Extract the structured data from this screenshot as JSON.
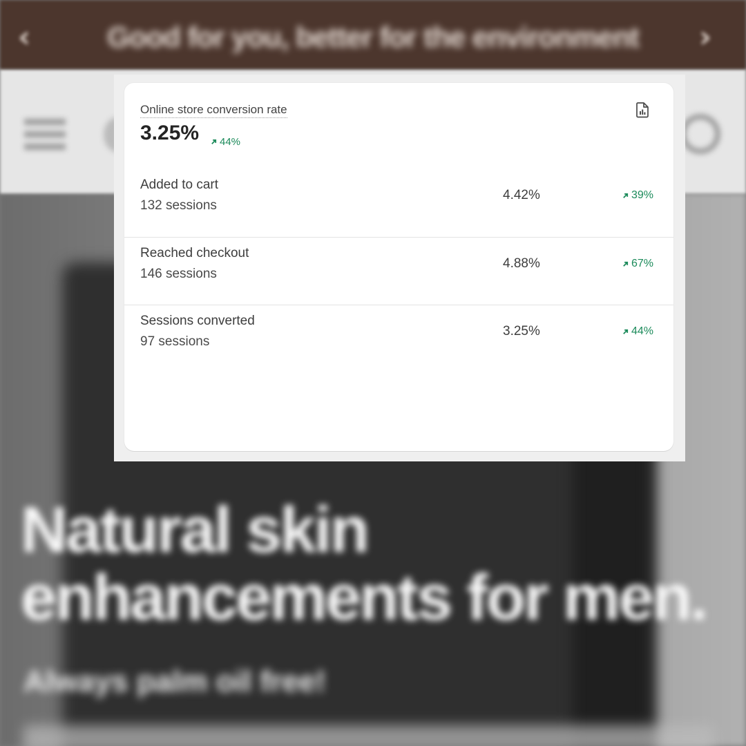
{
  "background": {
    "announcement": "Good for you, better for the environment",
    "arrow_left": "‹",
    "arrow_right": "›",
    "headline_line1": "Natural skin",
    "headline_line2": "enhancements for men.",
    "subheadline": "Always palm oil free!",
    "colors": {
      "announcement_bar": "#4c362d",
      "navbar": "#e6e6e6"
    }
  },
  "card": {
    "title": "Online store conversion rate",
    "value": "3.25%",
    "change": "44%",
    "report_icon": "report-chart-icon",
    "trend_icon": "arrow-up-right-icon",
    "accent_color": "#1b8a5a",
    "rows": [
      {
        "label": "Added to cart",
        "sessions": "132 sessions",
        "rate": "4.42%",
        "change": "39%"
      },
      {
        "label": "Reached checkout",
        "sessions": "146 sessions",
        "rate": "4.88%",
        "change": "67%"
      },
      {
        "label": "Sessions converted",
        "sessions": "97 sessions",
        "rate": "3.25%",
        "change": "44%"
      }
    ]
  }
}
